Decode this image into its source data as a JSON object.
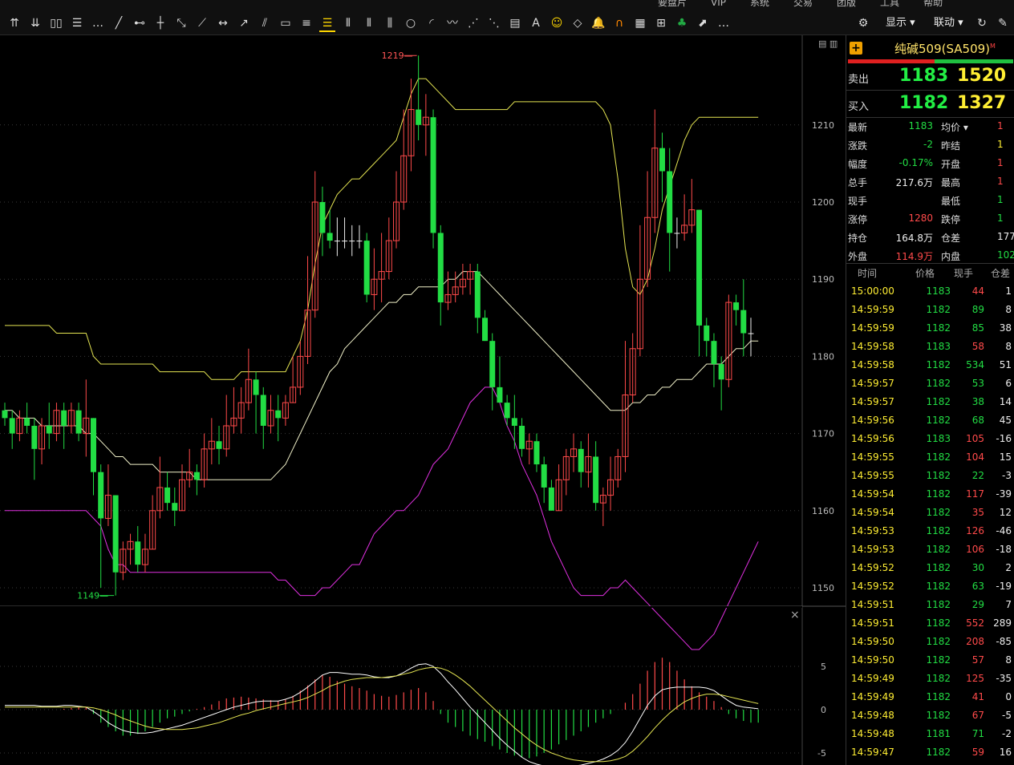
{
  "menu": [
    "要盘片",
    "VIP",
    "系统",
    "交易",
    "团版",
    "工具",
    "帮助"
  ],
  "toolbar": {
    "icons": [
      "arrow-up-double-icon",
      "arrow-down-double-icon",
      "columns-icon",
      "rows-icon",
      "more-icon",
      "line-tool-icon",
      "hline-tool-icon",
      "vline-tool-icon",
      "ray-tool-icon",
      "segment-tool-icon",
      "arrow-line-icon",
      "channel-tool-icon",
      "parallel-tool-icon",
      "rect-tool-icon",
      "fib-tool-icon",
      "fib-active-icon",
      "gann-tool-icon",
      "cycle-tool-icon",
      "period-tool-icon",
      "circle-tool-icon",
      "arc-tool-icon",
      "wave-tool-icon",
      "fan-tool-icon",
      "speed-line-icon",
      "ruler-icon",
      "text-tool-icon",
      "smile-icon",
      "eraser-icon",
      "alarm-icon",
      "magnet-icon",
      "calendar-icon",
      "grid-icon",
      "clover-icon",
      "export-icon",
      "more-icon-2"
    ],
    "right_display": "显示",
    "right_link": "联动"
  },
  "chart": {
    "high_label": "1219",
    "low_label": "1149",
    "price_ticks": [
      "1210",
      "1200",
      "1190",
      "1180",
      "1170",
      "1160",
      "1150"
    ],
    "macd_ticks": [
      "5",
      "0",
      "-5"
    ],
    "colors": {
      "up": "#ff4a4a",
      "down": "#22dd44",
      "boll": "#e5e552",
      "mid": "#f0f0c8",
      "ma": "#e030e0",
      "macd_dif": "#ffffff",
      "macd_dea": "#e5e552"
    }
  },
  "quote": {
    "title": "纯碱509(SA509)",
    "title_sup": "M",
    "sell": {
      "label": "卖出",
      "price": "1183",
      "vol": "1520"
    },
    "buy": {
      "label": "买入",
      "price": "1182",
      "vol": "1327"
    },
    "stats": [
      {
        "k1": "最新",
        "v1": "1183",
        "c1": "dn",
        "k2": "均价",
        "v2": "1",
        "c2": "up"
      },
      {
        "k1": "涨跌",
        "v1": "-2",
        "c1": "dn",
        "k2": "昨结",
        "v2": "1",
        "c2": "yl"
      },
      {
        "k1": "幅度",
        "v1": "-0.17%",
        "c1": "dn",
        "k2": "开盘",
        "v2": "1",
        "c2": "up"
      },
      {
        "k1": "总手",
        "v1": "217.6万",
        "c1": "wh",
        "k2": "最高",
        "v2": "1",
        "c2": "up"
      },
      {
        "k1": "现手",
        "v1": "",
        "c1": "wh",
        "k2": "最低",
        "v2": "1",
        "c2": "dn"
      },
      {
        "k1": "涨停",
        "v1": "1280",
        "c1": "up",
        "k2": "跌停",
        "v2": "1",
        "c2": "dn"
      },
      {
        "k1": "持仓",
        "v1": "164.8万",
        "c1": "wh",
        "k2": "仓差",
        "v2": "177",
        "c2": "wh"
      },
      {
        "k1": "外盘",
        "v1": "114.9万",
        "c1": "up",
        "k2": "内盘",
        "v2": "102.",
        "c2": "dn"
      }
    ],
    "tick_head": {
      "time": "时间",
      "price": "价格",
      "vol": "现手",
      "oi": "仓差"
    },
    "ticks": [
      {
        "time": "15:00:00",
        "price": "1183",
        "vol": "44",
        "oi": "1",
        "pc": "dn",
        "vc": "up"
      },
      {
        "time": "14:59:59",
        "price": "1182",
        "vol": "89",
        "oi": "8",
        "pc": "dn",
        "vc": "dn"
      },
      {
        "time": "14:59:59",
        "price": "1182",
        "vol": "85",
        "oi": "38",
        "pc": "dn",
        "vc": "dn"
      },
      {
        "time": "14:59:58",
        "price": "1183",
        "vol": "58",
        "oi": "8",
        "pc": "dn",
        "vc": "up"
      },
      {
        "time": "14:59:58",
        "price": "1182",
        "vol": "534",
        "oi": "51",
        "pc": "dn",
        "vc": "dn"
      },
      {
        "time": "14:59:57",
        "price": "1182",
        "vol": "53",
        "oi": "6",
        "pc": "dn",
        "vc": "dn"
      },
      {
        "time": "14:59:57",
        "price": "1182",
        "vol": "38",
        "oi": "14",
        "pc": "dn",
        "vc": "dn"
      },
      {
        "time": "14:59:56",
        "price": "1182",
        "vol": "68",
        "oi": "45",
        "pc": "dn",
        "vc": "dn"
      },
      {
        "time": "14:59:56",
        "price": "1183",
        "vol": "105",
        "oi": "-16",
        "pc": "dn",
        "vc": "up"
      },
      {
        "time": "14:59:55",
        "price": "1182",
        "vol": "104",
        "oi": "15",
        "pc": "dn",
        "vc": "up"
      },
      {
        "time": "14:59:55",
        "price": "1182",
        "vol": "22",
        "oi": "-3",
        "pc": "dn",
        "vc": "dn"
      },
      {
        "time": "14:59:54",
        "price": "1182",
        "vol": "117",
        "oi": "-39",
        "pc": "dn",
        "vc": "up"
      },
      {
        "time": "14:59:54",
        "price": "1182",
        "vol": "35",
        "oi": "12",
        "pc": "dn",
        "vc": "up"
      },
      {
        "time": "14:59:53",
        "price": "1182",
        "vol": "126",
        "oi": "-46",
        "pc": "dn",
        "vc": "up"
      },
      {
        "time": "14:59:53",
        "price": "1182",
        "vol": "106",
        "oi": "-18",
        "pc": "dn",
        "vc": "up"
      },
      {
        "time": "14:59:52",
        "price": "1182",
        "vol": "30",
        "oi": "2",
        "pc": "dn",
        "vc": "dn"
      },
      {
        "time": "14:59:52",
        "price": "1182",
        "vol": "63",
        "oi": "-19",
        "pc": "dn",
        "vc": "dn"
      },
      {
        "time": "14:59:51",
        "price": "1182",
        "vol": "29",
        "oi": "7",
        "pc": "dn",
        "vc": "dn"
      },
      {
        "time": "14:59:51",
        "price": "1182",
        "vol": "552",
        "oi": "289",
        "pc": "dn",
        "vc": "up"
      },
      {
        "time": "14:59:50",
        "price": "1182",
        "vol": "208",
        "oi": "-85",
        "pc": "dn",
        "vc": "up"
      },
      {
        "time": "14:59:50",
        "price": "1182",
        "vol": "57",
        "oi": "8",
        "pc": "dn",
        "vc": "up"
      },
      {
        "time": "14:59:49",
        "price": "1182",
        "vol": "125",
        "oi": "-35",
        "pc": "dn",
        "vc": "up"
      },
      {
        "time": "14:59:49",
        "price": "1182",
        "vol": "41",
        "oi": "0",
        "pc": "dn",
        "vc": "up"
      },
      {
        "time": "14:59:48",
        "price": "1182",
        "vol": "67",
        "oi": "-5",
        "pc": "dn",
        "vc": "up"
      },
      {
        "time": "14:59:48",
        "price": "1181",
        "vol": "71",
        "oi": "-2",
        "pc": "dn",
        "vc": "dn"
      },
      {
        "time": "14:59:47",
        "price": "1182",
        "vol": "59",
        "oi": "16",
        "pc": "dn",
        "vc": "up"
      }
    ]
  },
  "candles": [
    [
      1173,
      1172,
      1174,
      1171
    ],
    [
      1172,
      1170,
      1173,
      1168
    ],
    [
      1170,
      1172,
      1173,
      1169
    ],
    [
      1172,
      1171,
      1174,
      1170
    ],
    [
      1171,
      1168,
      1172,
      1164
    ],
    [
      1168,
      1171,
      1172,
      1166
    ],
    [
      1171,
      1170,
      1174,
      1168
    ],
    [
      1170,
      1173,
      1174,
      1169
    ],
    [
      1173,
      1171,
      1174,
      1168
    ],
    [
      1171,
      1173,
      1174,
      1170
    ],
    [
      1173,
      1170,
      1174,
      1169
    ],
    [
      1170,
      1172,
      1177,
      1167
    ],
    [
      1172,
      1165,
      1172,
      1162
    ],
    [
      1165,
      1159,
      1166,
      1150
    ],
    [
      1159,
      1162,
      1166,
      1158
    ],
    [
      1162,
      1152,
      1162,
      1149
    ],
    [
      1152,
      1155,
      1156,
      1151
    ],
    [
      1155,
      1156,
      1157,
      1153
    ],
    [
      1156,
      1153,
      1158,
      1152
    ],
    [
      1153,
      1155,
      1157,
      1152
    ],
    [
      1155,
      1160,
      1162,
      1155
    ],
    [
      1160,
      1163,
      1167,
      1159
    ],
    [
      1163,
      1161,
      1165,
      1160
    ],
    [
      1161,
      1160,
      1163,
      1158
    ],
    [
      1160,
      1164,
      1166,
      1160
    ],
    [
      1164,
      1165,
      1168,
      1163
    ],
    [
      1165,
      1164,
      1166,
      1162
    ],
    [
      1164,
      1168,
      1170,
      1163
    ],
    [
      1168,
      1169,
      1172,
      1166
    ],
    [
      1169,
      1168,
      1171,
      1166
    ],
    [
      1168,
      1171,
      1175,
      1167
    ],
    [
      1171,
      1172,
      1176,
      1170
    ],
    [
      1172,
      1174,
      1176,
      1170
    ],
    [
      1174,
      1177,
      1181,
      1173
    ],
    [
      1177,
      1175,
      1178,
      1170
    ],
    [
      1175,
      1171,
      1176,
      1168
    ],
    [
      1171,
      1173,
      1175,
      1170
    ],
    [
      1173,
      1172,
      1175,
      1169
    ],
    [
      1172,
      1174,
      1175,
      1171
    ],
    [
      1174,
      1176,
      1180,
      1174
    ],
    [
      1176,
      1180,
      1182,
      1175
    ],
    [
      1180,
      1186,
      1193,
      1179
    ],
    [
      1186,
      1200,
      1204,
      1185
    ],
    [
      1200,
      1196,
      1202,
      1193
    ],
    [
      1196,
      1195,
      1199,
      1194
    ],
    [
      1195,
      1195,
      1198,
      1193
    ],
    [
      1195,
      1195,
      1198,
      1194
    ],
    [
      1195,
      1195,
      1197,
      1193
    ],
    [
      1195,
      1195,
      1197,
      1194
    ],
    [
      1195,
      1188,
      1196,
      1187
    ],
    [
      1188,
      1190,
      1194,
      1186
    ],
    [
      1190,
      1191,
      1196,
      1187
    ],
    [
      1191,
      1195,
      1198,
      1190
    ],
    [
      1195,
      1200,
      1204,
      1194
    ],
    [
      1200,
      1206,
      1212,
      1199
    ],
    [
      1206,
      1212,
      1216,
      1204
    ],
    [
      1212,
      1210,
      1219,
      1208
    ],
    [
      1210,
      1211,
      1214,
      1206
    ],
    [
      1211,
      1196,
      1212,
      1194
    ],
    [
      1196,
      1187,
      1197,
      1184
    ],
    [
      1187,
      1188,
      1191,
      1186
    ],
    [
      1188,
      1189,
      1191,
      1187
    ],
    [
      1189,
      1190,
      1192,
      1188
    ],
    [
      1190,
      1191,
      1192,
      1188
    ],
    [
      1191,
      1185,
      1192,
      1183
    ],
    [
      1185,
      1182,
      1186,
      1182
    ],
    [
      1182,
      1176,
      1183,
      1173
    ],
    [
      1176,
      1174,
      1180,
      1174
    ],
    [
      1174,
      1172,
      1175,
      1171
    ],
    [
      1172,
      1171,
      1175,
      1168
    ],
    [
      1171,
      1168,
      1172,
      1167
    ],
    [
      1168,
      1169,
      1170,
      1166
    ],
    [
      1169,
      1166,
      1170,
      1165
    ],
    [
      1166,
      1163,
      1167,
      1161
    ],
    [
      1163,
      1160,
      1164,
      1160
    ],
    [
      1160,
      1164,
      1166,
      1160
    ],
    [
      1164,
      1167,
      1168,
      1162
    ],
    [
      1167,
      1168,
      1170,
      1165
    ],
    [
      1168,
      1165,
      1169,
      1163
    ],
    [
      1165,
      1167,
      1170,
      1163
    ],
    [
      1167,
      1161,
      1169,
      1160
    ],
    [
      1161,
      1162,
      1163,
      1158
    ],
    [
      1162,
      1164,
      1167,
      1160
    ],
    [
      1164,
      1167,
      1168,
      1163
    ],
    [
      1167,
      1175,
      1182,
      1165
    ],
    [
      1175,
      1181,
      1183,
      1174
    ],
    [
      1181,
      1190,
      1197,
      1180
    ],
    [
      1190,
      1198,
      1204,
      1189
    ],
    [
      1198,
      1207,
      1212,
      1196
    ],
    [
      1207,
      1204,
      1209,
      1200
    ],
    [
      1204,
      1196,
      1207,
      1191
    ],
    [
      1196,
      1196,
      1198,
      1194
    ],
    [
      1196,
      1197,
      1201,
      1195
    ],
    [
      1197,
      1199,
      1203,
      1196
    ],
    [
      1199,
      1184,
      1199,
      1180
    ],
    [
      1184,
      1182,
      1185,
      1180
    ],
    [
      1182,
      1179,
      1183,
      1176
    ],
    [
      1179,
      1177,
      1180,
      1173
    ],
    [
      1177,
      1187,
      1188,
      1176
    ],
    [
      1187,
      1186,
      1188,
      1184
    ],
    [
      1186,
      1183,
      1190,
      1180
    ],
    [
      1183,
      1183,
      1185,
      1180
    ]
  ],
  "boll_up": [
    1184,
    1184,
    1184,
    1184,
    1184,
    1184,
    1184,
    1183,
    1183,
    1183,
    1183,
    1183,
    1180,
    1179,
    1179,
    1179,
    1179,
    1179,
    1179,
    1179,
    1179,
    1178,
    1178,
    1178,
    1178,
    1178,
    1178,
    1178,
    1177,
    1177,
    1177,
    1177,
    1178,
    1178,
    1178,
    1178,
    1178,
    1178,
    1178,
    1180,
    1182,
    1186,
    1192,
    1197,
    1199,
    1201,
    1202,
    1203,
    1203,
    1204,
    1205,
    1206,
    1207,
    1208,
    1211,
    1214,
    1216,
    1216,
    1215,
    1214,
    1213,
    1212,
    1212,
    1212,
    1212,
    1212,
    1212,
    1212,
    1212,
    1213,
    1213,
    1213,
    1213,
    1213,
    1213,
    1213,
    1213,
    1213,
    1213,
    1213,
    1213,
    1212,
    1210,
    1203,
    1194,
    1189,
    1188,
    1190,
    1194,
    1199,
    1202,
    1205,
    1208,
    1210,
    1211,
    1211,
    1211,
    1211,
    1211,
    1211,
    1211,
    1211,
    1211
  ],
  "boll_mid": [
    1173,
    1173,
    1172,
    1172,
    1172,
    1171,
    1171,
    1171,
    1171,
    1171,
    1171,
    1170,
    1170,
    1169,
    1168,
    1167,
    1167,
    1166,
    1166,
    1166,
    1166,
    1165,
    1165,
    1165,
    1165,
    1165,
    1164,
    1164,
    1164,
    1164,
    1164,
    1164,
    1164,
    1164,
    1164,
    1164,
    1164,
    1165,
    1166,
    1168,
    1170,
    1172,
    1174,
    1176,
    1178,
    1179,
    1181,
    1182,
    1183,
    1184,
    1185,
    1186,
    1187,
    1187,
    1188,
    1188,
    1189,
    1189,
    1189,
    1189,
    1190,
    1190,
    1191,
    1191,
    1191,
    1190,
    1189,
    1188,
    1187,
    1186,
    1185,
    1184,
    1183,
    1182,
    1181,
    1180,
    1179,
    1178,
    1177,
    1176,
    1175,
    1174,
    1173,
    1173,
    1173,
    1174,
    1174,
    1175,
    1175,
    1176,
    1176,
    1177,
    1177,
    1177,
    1178,
    1179,
    1179,
    1179,
    1180,
    1181,
    1181,
    1182,
    1182
  ],
  "ma_low": [
    1160,
    1160,
    1160,
    1160,
    1160,
    1160,
    1160,
    1160,
    1160,
    1160,
    1160,
    1160,
    1159,
    1158,
    1155,
    1153,
    1153,
    1152,
    1152,
    1152,
    1152,
    1152,
    1152,
    1152,
    1152,
    1152,
    1152,
    1152,
    1152,
    1152,
    1152,
    1152,
    1152,
    1152,
    1152,
    1152,
    1152,
    1151,
    1151,
    1150,
    1149,
    1149,
    1149,
    1150,
    1150,
    1151,
    1152,
    1153,
    1153,
    1155,
    1157,
    1158,
    1159,
    1160,
    1160,
    1161,
    1162,
    1164,
    1166,
    1167,
    1168,
    1170,
    1172,
    1174,
    1175,
    1176,
    1176,
    1174,
    1171,
    1169,
    1166,
    1164,
    1162,
    1159,
    1156,
    1154,
    1152,
    1150,
    1149,
    1149,
    1149,
    1149,
    1150,
    1150,
    1151,
    1150,
    1149,
    1148,
    1147,
    1146,
    1145,
    1144,
    1143,
    1142,
    1142,
    1143,
    1144,
    1146,
    1148,
    1150,
    1152,
    1154,
    1156
  ],
  "macd_bars": [
    0,
    0,
    0,
    0,
    0,
    0,
    0,
    0,
    0.1,
    0.2,
    0.3,
    0.3,
    -0.5,
    -1.5,
    -2,
    -2.5,
    -3,
    -3,
    -2.8,
    -2.5,
    -2,
    -1.5,
    -1,
    -0.8,
    -0.5,
    -0.2,
    0.1,
    0.3,
    0.6,
    1,
    1.3,
    1.4,
    1.5,
    1.4,
    1.3,
    1.2,
    1.1,
    1,
    1.2,
    1.6,
    2.2,
    2.8,
    3.5,
    4,
    3.8,
    3.3,
    3,
    2.7,
    2.5,
    2.2,
    1.8,
    1.6,
    1.5,
    1.7,
    2,
    2.3,
    2.5,
    2,
    1,
    -0.5,
    -1.5,
    -2,
    -2.5,
    -3,
    -3.4,
    -3.7,
    -4.2,
    -4.6,
    -5,
    -5.3,
    -5.5,
    -5.6,
    -5.4,
    -5,
    -4.6,
    -4,
    -3.5,
    -3,
    -2.5,
    -2,
    -1.5,
    -1,
    -0.5,
    0,
    0.8,
    1.8,
    3,
    4.5,
    5.5,
    6,
    5.5,
    4.5,
    3.5,
    2.7,
    2,
    1.5,
    1,
    0.3,
    -0.5,
    -1,
    -1.3,
    -1.5,
    -1.5
  ],
  "macd_dif": [
    0.5,
    0.5,
    0.5,
    0.5,
    0.5,
    0.4,
    0.4,
    0.4,
    0.5,
    0.5,
    0.4,
    0.3,
    -0.2,
    -0.8,
    -1.5,
    -2,
    -2.4,
    -2.6,
    -2.7,
    -2.7,
    -2.6,
    -2.4,
    -2.2,
    -2,
    -1.8,
    -1.5,
    -1.2,
    -0.9,
    -0.6,
    -0.3,
    0,
    0.3,
    0.5,
    0.7,
    0.9,
    1,
    1,
    1,
    1.2,
    1.5,
    2,
    2.6,
    3.3,
    4,
    4.3,
    4.3,
    4.2,
    4.1,
    4.1,
    4,
    3.8,
    3.7,
    3.7,
    3.9,
    4.3,
    4.8,
    5.2,
    5.3,
    5,
    4.2,
    3.2,
    2.3,
    1.3,
    0.3,
    -0.6,
    -1.5,
    -2.4,
    -3.3,
    -4.1,
    -4.8,
    -5.5,
    -6,
    -6.3,
    -6.5,
    -6.6,
    -6.6,
    -6.6,
    -6.5,
    -6.4,
    -6.2,
    -6,
    -5.7,
    -5.3,
    -4.7,
    -3.8,
    -2.5,
    -1,
    0.5,
    1.6,
    2.3,
    2.5,
    2.6,
    2.6,
    2.6,
    2.6,
    2.5,
    2.2,
    1.6,
    1,
    0.5,
    0.3,
    0.2,
    0.1
  ],
  "macd_dea": [
    0.3,
    0.3,
    0.3,
    0.3,
    0.3,
    0.3,
    0.3,
    0.3,
    0.3,
    0.3,
    0.3,
    0.3,
    0.2,
    0,
    -0.3,
    -0.6,
    -1,
    -1.3,
    -1.6,
    -1.9,
    -2.1,
    -2.2,
    -2.3,
    -2.3,
    -2.3,
    -2.2,
    -2.1,
    -1.9,
    -1.7,
    -1.5,
    -1.2,
    -0.9,
    -0.6,
    -0.4,
    -0.1,
    0.1,
    0.3,
    0.5,
    0.7,
    0.9,
    1.1,
    1.4,
    1.8,
    2.2,
    2.7,
    3,
    3.3,
    3.5,
    3.6,
    3.7,
    3.7,
    3.7,
    3.8,
    3.9,
    4.1,
    4.3,
    4.6,
    4.8,
    4.9,
    4.8,
    4.5,
    4,
    3.4,
    2.7,
    1.9,
    1.1,
    0.3,
    -0.5,
    -1.3,
    -2.1,
    -2.8,
    -3.5,
    -4.1,
    -4.6,
    -5,
    -5.3,
    -5.6,
    -5.8,
    -5.9,
    -6,
    -6,
    -6,
    -5.9,
    -5.7,
    -5.4,
    -4.8,
    -4,
    -3.1,
    -2.1,
    -1.2,
    -0.4,
    0.3,
    0.9,
    1.3,
    1.6,
    1.8,
    1.8,
    1.7,
    1.5,
    1.3,
    1.1,
    0.9,
    0.7
  ]
}
